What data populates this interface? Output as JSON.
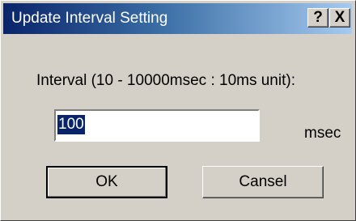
{
  "window": {
    "title": "Update Interval Setting",
    "help_label": "?",
    "close_label": "X"
  },
  "form": {
    "interval_label": "Interval (10 - 10000msec : 10ms unit):",
    "interval_value": "100",
    "unit": "msec"
  },
  "buttons": {
    "ok_label": "OK",
    "cancel_label": "Cansel"
  }
}
